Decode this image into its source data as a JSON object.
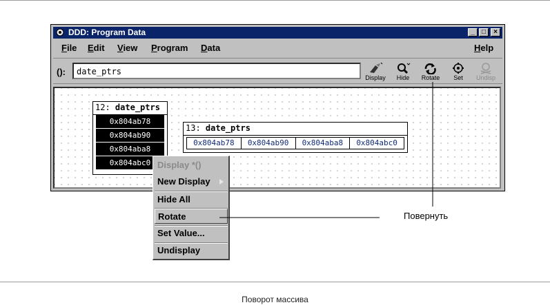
{
  "window": {
    "title": "DDD: Program Data",
    "controls": [
      "_",
      "□",
      "×"
    ]
  },
  "menu": {
    "items": [
      {
        "first": "F",
        "rest": "ile"
      },
      {
        "first": "E",
        "rest": "dit"
      },
      {
        "first": "V",
        "rest": "iew"
      },
      {
        "first": "P",
        "rest": "rogram"
      },
      {
        "first": "D",
        "rest": "ata"
      }
    ],
    "help": {
      "first": "H",
      "rest": "elp"
    }
  },
  "command": {
    "label": "():",
    "value": "date_ptrs"
  },
  "toolbar": [
    {
      "label": "Display",
      "icon": "display-icon",
      "enabled": true
    },
    {
      "label": "Hide",
      "icon": "hide-icon",
      "enabled": true
    },
    {
      "label": "Rotate",
      "icon": "rotate-icon",
      "enabled": true
    },
    {
      "label": "Set",
      "icon": "set-icon",
      "enabled": true
    },
    {
      "label": "Undisp",
      "icon": "undisplay-icon",
      "enabled": false
    }
  ],
  "display12": {
    "number": "12:",
    "name": "date_ptrs",
    "values": [
      "0x804ab78",
      "0x804ab90",
      "0x804aba8",
      "0x804abc0"
    ]
  },
  "display13": {
    "number": "13:",
    "name": "date_ptrs",
    "values": [
      "0x804ab78",
      "0x804ab90",
      "0x804aba8",
      "0x804abc0"
    ]
  },
  "popup": {
    "items": [
      {
        "label": "Display *()",
        "enabled": false
      },
      {
        "label": "New Display",
        "enabled": true,
        "submenu": true
      },
      {
        "label": "Hide All",
        "enabled": true
      },
      {
        "label": "Rotate",
        "enabled": true,
        "active": true
      },
      {
        "label": "Set Value...",
        "enabled": true
      },
      {
        "label": "Undisplay",
        "enabled": true
      }
    ]
  },
  "callout": "Повернуть",
  "caption": "Поворот массива"
}
